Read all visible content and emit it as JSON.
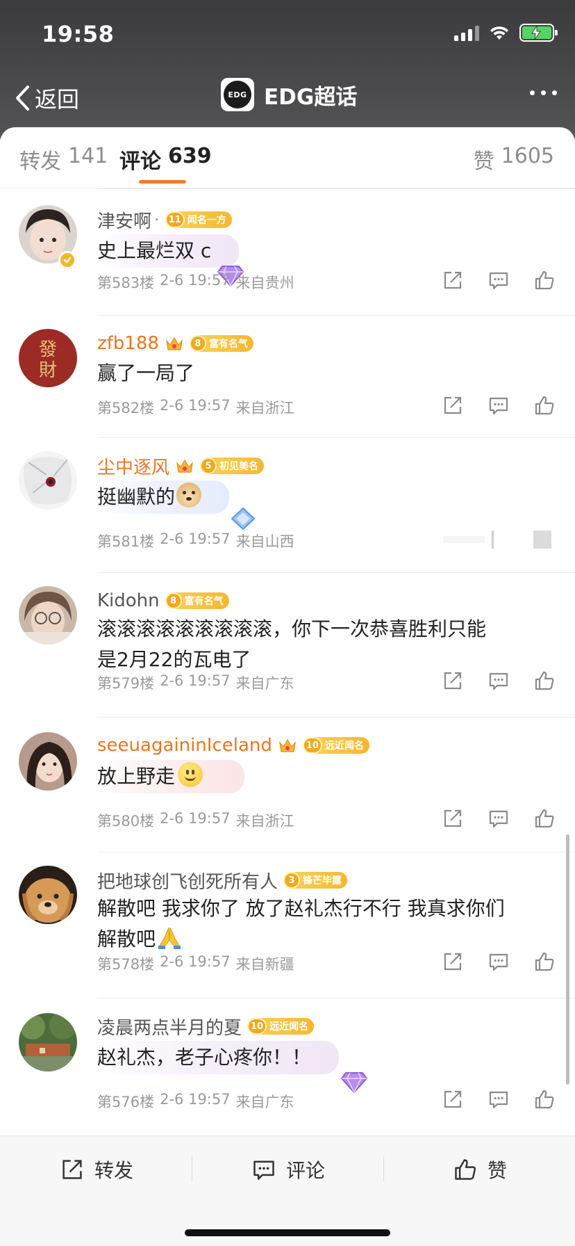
{
  "status_bar": {
    "time": "19:58"
  },
  "nav": {
    "back_label": "返回",
    "logo_text": "EDG",
    "title": "EDG超话"
  },
  "tabs": {
    "repost_label": "转发",
    "repost_count": "141",
    "comments_label": "评论",
    "comments_count": "639",
    "likes_label": "赞",
    "likes_count": "1605"
  },
  "comments": [
    {
      "name": "津安啊",
      "name_suffix": "·",
      "badge_level": "11",
      "badge_text": "闻名一方",
      "text": "史上最烂双 c",
      "floor": "第583楼",
      "time": "2-6 19:57",
      "location": "来自贵州"
    },
    {
      "name": "zfb188",
      "badge_level": "8",
      "badge_text": "富有名气",
      "text": "赢了一局了",
      "floor": "第582楼",
      "time": "2-6 19:57",
      "location": "来自浙江"
    },
    {
      "name": "尘中逐风",
      "badge_level": "5",
      "badge_text": "初见美名",
      "text": "挺幽默的",
      "floor": "第581楼",
      "time": "2-6 19:57",
      "location": "来自山西"
    },
    {
      "name": "Kidohn",
      "badge_level": "8",
      "badge_text": "富有名气",
      "text_line1": "滚滚滚滚滚滚滚滚滚，你下一次恭喜胜利只能",
      "text_line2": "是2月22的瓦电了",
      "floor": "第579楼",
      "time": "2-6 19:57",
      "location": "来自广东"
    },
    {
      "name": "seeuagaininIceland",
      "badge_level": "10",
      "badge_text": "远近闻名",
      "text": "放上野走",
      "floor": "第580楼",
      "time": "2-6 19:57",
      "location": "来自浙江"
    },
    {
      "name": "把地球创飞创死所有人",
      "badge_level": "3",
      "badge_text": "锋芒毕露",
      "text_line1": "解散吧 我求你了 放了赵礼杰行不行 我真求你们",
      "text_line2": "解散吧",
      "floor": "第578楼",
      "time": "2-6 19:57",
      "location": "来自新疆"
    },
    {
      "name": "凌晨两点半月的夏",
      "badge_level": "10",
      "badge_text": "远近闻名",
      "text": "赵礼杰，老子心疼你！！",
      "floor": "第576楼",
      "time": "2-6 19:57",
      "location": "来自广东"
    }
  ],
  "toolbar": {
    "repost": "转发",
    "comment": "评论",
    "like": "赞"
  },
  "colors": {
    "accent": "#f07c2a",
    "badge_gold": "#f6b730",
    "username_orange": "#eb7623"
  },
  "icons": [
    "chevron-left-icon",
    "more-icon",
    "share-icon",
    "comment-icon",
    "like-icon",
    "crown-icon",
    "gem-icon"
  ]
}
